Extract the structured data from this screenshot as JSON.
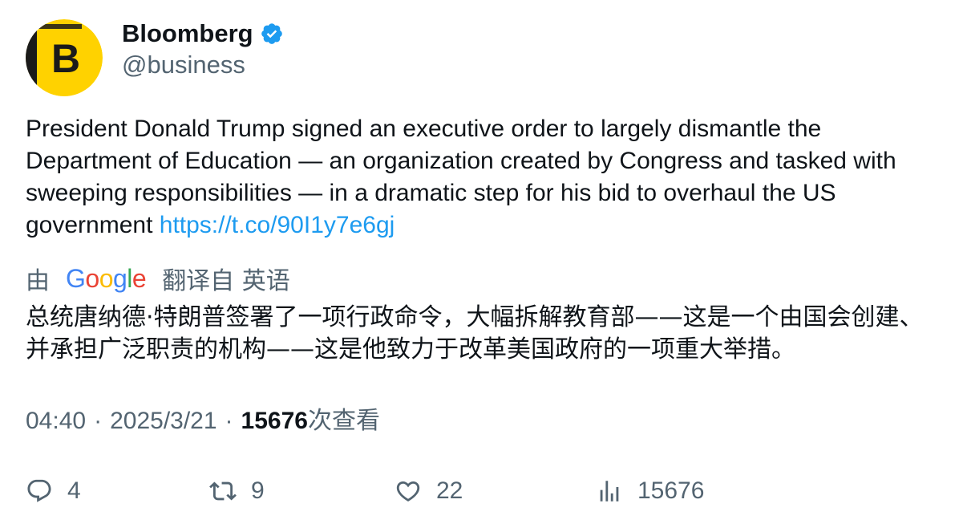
{
  "author": {
    "name": "Bloomberg",
    "handle": "@business",
    "avatar_letter": "B",
    "avatar_colors": {
      "yellow": "#ffd200",
      "dark": "#1a1a1a"
    },
    "verified_color": "#1d9bf0"
  },
  "tweet": {
    "text": "President Donald Trump signed an executive order to largely dismantle the Department of Education — an organization created by Congress and tasked with sweeping responsibilities — in a dramatic step for his bid to overhaul the US government ",
    "link": "https://t.co/90I1y7e6gj"
  },
  "translation": {
    "prefix": "由",
    "provider": [
      "G",
      "o",
      "o",
      "g",
      "l",
      "e"
    ],
    "suffix": "翻译自 英语",
    "text": "总统唐纳德·特朗普签署了一项行政命令，大幅拆解教育部——这是一个由国会创建、并承担广泛职责的机构——这是他致力于改革美国政府的一项重大举措。"
  },
  "meta": {
    "time": "04:40",
    "date": "2025/3/21",
    "separator": "·",
    "views": "15676",
    "views_label": "次查看"
  },
  "actions": {
    "replies": "4",
    "retweets": "9",
    "likes": "22",
    "views": "15676"
  },
  "colors": {
    "text": "#0f1419",
    "secondary": "#536471",
    "link": "#1d9bf0"
  }
}
